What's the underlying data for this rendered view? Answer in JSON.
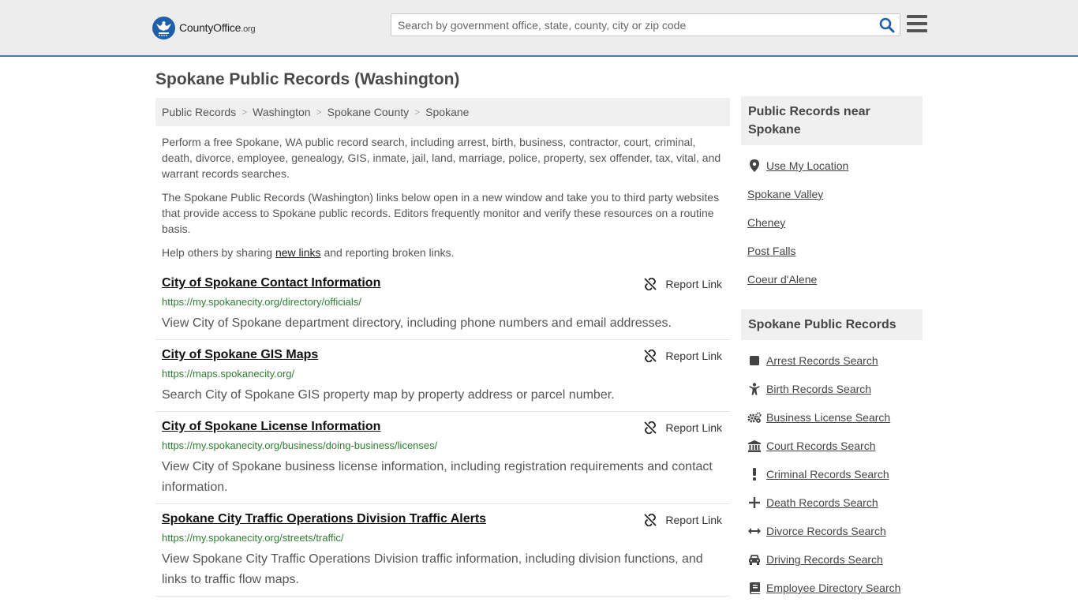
{
  "header": {
    "logo_main": "CountyOffice",
    "logo_tld": ".org",
    "search_placeholder": "Search by government office, state, county, city or zip code"
  },
  "page": {
    "title": "Spokane Public Records (Washington)"
  },
  "breadcrumb": [
    "Public Records",
    "Washington",
    "Spokane County",
    "Spokane"
  ],
  "intro": {
    "p1": "Perform a free Spokane, WA public record search, including arrest, birth, business, contractor, court, criminal, death, divorce, employee, genealogy, GIS, inmate, jail, land, marriage, police, property, sex offender, tax, vital, and warrant records searches.",
    "p2": "The Spokane Public Records (Washington) links below open in a new window and take you to third party websites that provide access to Spokane public records. Editors frequently monitor and verify these resources on a routine basis.",
    "p3_before": "Help others by sharing ",
    "p3_link": "new links",
    "p3_after": " and reporting broken links."
  },
  "report_label": "Report Link",
  "records": [
    {
      "title": "City of Spokane Contact Information",
      "url": "https://my.spokanecity.org/directory/officials/",
      "desc": "View City of Spokane department directory, including phone numbers and email addresses."
    },
    {
      "title": "City of Spokane GIS Maps",
      "url": "https://maps.spokanecity.org/",
      "desc": "Search City of Spokane GIS property map by property address or parcel number."
    },
    {
      "title": "City of Spokane License Information",
      "url": "https://my.spokanecity.org/business/doing-business/licenses/",
      "desc": "View City of Spokane business license information, including registration requirements and contact information."
    },
    {
      "title": "Spokane City Traffic Operations Division Traffic Alerts",
      "url": "https://my.spokanecity.org/streets/traffic/",
      "desc": "View Spokane City Traffic Operations Division traffic information, including division functions, and links to traffic flow maps."
    }
  ],
  "sidebar": {
    "nearby_heading": "Public Records near Spokane",
    "use_location": "Use My Location",
    "nearby": [
      "Spokane Valley",
      "Cheney",
      "Post Falls",
      "Coeur d'Alene"
    ],
    "records_heading": "Spokane Public Records",
    "record_links": [
      {
        "label": "Arrest Records Search",
        "icon": "square-icon"
      },
      {
        "label": "Birth Records Search",
        "icon": "child-icon"
      },
      {
        "label": "Business License Search",
        "icon": "gears-icon"
      },
      {
        "label": "Court Records Search",
        "icon": "courthouse-icon"
      },
      {
        "label": "Criminal Records Search",
        "icon": "exclamation-icon"
      },
      {
        "label": "Death Records Search",
        "icon": "plus-icon"
      },
      {
        "label": "Divorce Records Search",
        "icon": "arrows-h-icon"
      },
      {
        "label": "Driving Records Search",
        "icon": "car-icon"
      },
      {
        "label": "Employee Directory Search",
        "icon": "book-icon"
      }
    ]
  }
}
